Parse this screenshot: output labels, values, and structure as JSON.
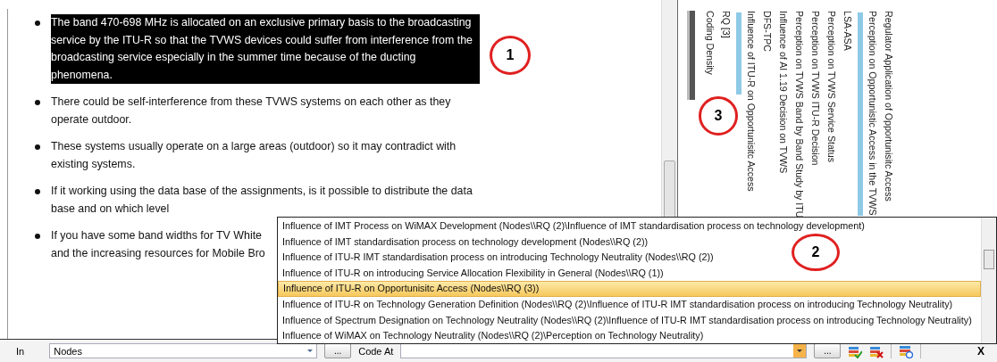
{
  "document": {
    "bullets": [
      {
        "text": "The band 470-698 MHz is allocated on an exclusive primary basis to the broadcasting service by the ITU-R so that the TVWS devices could suffer from interference from the broadcasting service especially in the summer time because of the ducting phenomena.",
        "selected": true
      },
      {
        "text": "There could be self-interference from these TVWS systems on each other as they operate outdoor.",
        "selected": false
      },
      {
        "text": "These systems usually operate on a large areas (outdoor)  so it may contradict with existing systems.",
        "selected": false
      },
      {
        "text": "If it working using the data base of the assignments, is it possible to distribute the data base and on which level",
        "selected": false
      },
      {
        "text": "If you have some band widths for TV White\nand the increasing resources for Mobile Bro",
        "selected": false
      }
    ]
  },
  "coding_stripes": {
    "columns": [
      {
        "kind": "density",
        "label": "Coding Density"
      },
      {
        "kind": "label",
        "label": "RQ [3]"
      },
      {
        "kind": "stripe-short"
      },
      {
        "kind": "label",
        "label": "Influence of ITU-R on Opportunisitc Access"
      },
      {
        "kind": "label",
        "label": "DFS-TPC"
      },
      {
        "kind": "label",
        "label": "Influence of AI 1.19 Decision on TVWS"
      },
      {
        "kind": "label",
        "label": "Perception on TVWS Band by Band Study by ITU"
      },
      {
        "kind": "label",
        "label": "Perception on TVWS ITU-R Decision"
      },
      {
        "kind": "label",
        "label": "Perception on TVWS Service Status"
      },
      {
        "kind": "label",
        "label": "LSA-ASA"
      },
      {
        "kind": "stripe-long"
      },
      {
        "kind": "label",
        "label": "Perception on Opportunistic Access in the TVWS"
      },
      {
        "kind": "label",
        "label": "Regulator Application of Opportunisitc Access"
      }
    ]
  },
  "dropdown": {
    "items": [
      {
        "text": "Influence of IMT Process on WiMAX Development (Nodes\\\\RQ (2)\\Influence of IMT standardisation process on technology development)",
        "selected": false
      },
      {
        "text": "Influence of IMT standardisation process on technology development (Nodes\\\\RQ (2))",
        "selected": false
      },
      {
        "text": "Influence of ITU-R IMT standardisation process on introducing Technology Neutrality (Nodes\\\\RQ (2))",
        "selected": false
      },
      {
        "text": "Influence of ITU-R on introducing Service Allocation Flexibility in General (Nodes\\\\RQ (1))",
        "selected": false
      },
      {
        "text": "Influence of ITU-R on Opportunisitc Access (Nodes\\\\RQ (3))",
        "selected": true
      },
      {
        "text": "Influence of ITU-R on Technology Generation Definition (Nodes\\\\RQ (2)\\Influence of ITU-R IMT standardisation process on introducing Technology Neutrality)",
        "selected": false
      },
      {
        "text": "Influence of Spectrum Designation on Technology Neutrality (Nodes\\\\RQ (2)\\Influence of ITU-R IMT standardisation process on introducing Technology Neutrality)",
        "selected": false
      },
      {
        "text": "Influence of WiMAX on Technology Neutrality (Nodes\\\\RQ (2)\\Perception on Technology Neutrality)",
        "selected": false
      }
    ]
  },
  "annotations": [
    {
      "label": "1"
    },
    {
      "label": "2"
    },
    {
      "label": "3"
    }
  ],
  "coding_bar": {
    "in_label": "In",
    "in_value": "Nodes",
    "in_browse": "...",
    "code_at_label": "Code At",
    "code_at_browse": "...",
    "close": "X"
  }
}
